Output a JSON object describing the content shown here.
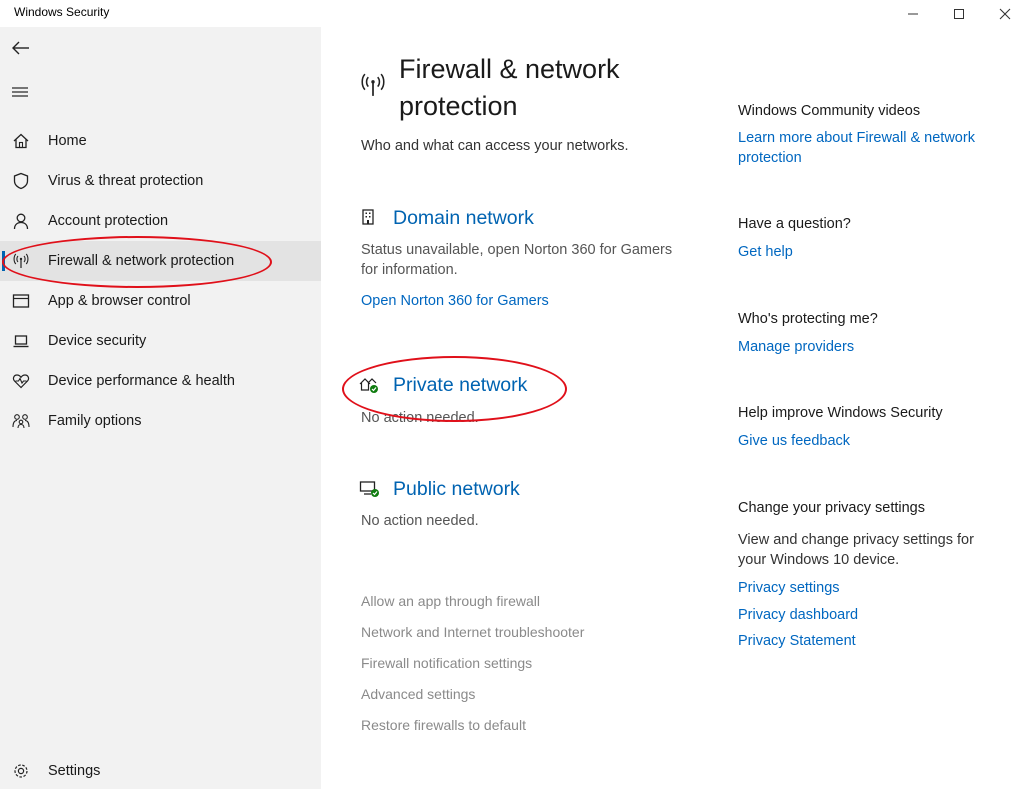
{
  "window": {
    "title": "Windows Security"
  },
  "sidebar": {
    "items": [
      {
        "label": "Home",
        "icon": "home-icon"
      },
      {
        "label": "Virus & threat protection",
        "icon": "shield-icon"
      },
      {
        "label": "Account protection",
        "icon": "person-icon"
      },
      {
        "label": "Firewall & network protection",
        "icon": "antenna-icon",
        "selected": true
      },
      {
        "label": "App & browser control",
        "icon": "app-window-icon"
      },
      {
        "label": "Device security",
        "icon": "laptop-icon"
      },
      {
        "label": "Device performance & health",
        "icon": "heart-pulse-icon"
      },
      {
        "label": "Family options",
        "icon": "family-icon"
      }
    ],
    "settings_label": "Settings"
  },
  "main": {
    "title": "Firewall & network protection",
    "subtitle": "Who and what can access your networks.",
    "networks": {
      "domain": {
        "title": "Domain network",
        "desc": "Status unavailable, open Norton 360 for Gamers for information.",
        "link": "Open Norton 360 for Gamers"
      },
      "private": {
        "title": "Private network",
        "desc": "No action needed."
      },
      "public": {
        "title": "Public network",
        "desc": "No action needed."
      }
    },
    "settings_links": [
      "Allow an app through firewall",
      "Network and Internet troubleshooter",
      "Firewall notification settings",
      "Advanced settings",
      "Restore firewalls to default"
    ]
  },
  "right": {
    "community": {
      "heading": "Windows Community videos",
      "link": "Learn more about Firewall & network protection"
    },
    "question": {
      "heading": "Have a question?",
      "link": "Get help"
    },
    "protecting": {
      "heading": "Who's protecting me?",
      "link": "Manage providers"
    },
    "improve": {
      "heading": "Help improve Windows Security",
      "link": "Give us feedback"
    },
    "privacy": {
      "heading": "Change your privacy settings",
      "text": "View and change privacy settings for your Windows 10 device.",
      "links": [
        "Privacy settings",
        "Privacy dashboard",
        "Privacy Statement"
      ]
    }
  },
  "colors": {
    "accent": "#0063b1",
    "link": "#0067c0",
    "annotation": "#e0101a",
    "status_ok": "#107c10"
  }
}
